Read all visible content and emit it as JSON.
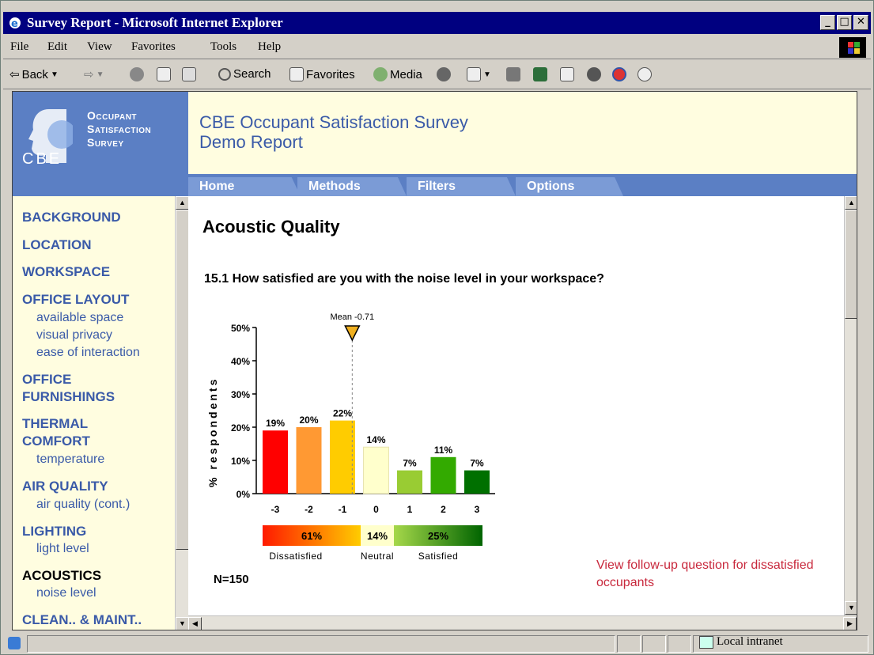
{
  "window": {
    "title": "Survey Report - Microsoft Internet Explorer",
    "min_label": "_",
    "max_label": "□",
    "close_label": "✕"
  },
  "menu": [
    "File",
    "Edit",
    "View",
    "Favorites",
    "Tools",
    "Help"
  ],
  "toolbar": {
    "back_label": "Back",
    "search_label": "Search",
    "favorites_label": "Favorites",
    "media_label": "Media"
  },
  "banner": {
    "logo_line1": "Occupant",
    "logo_line2": "Satisfaction",
    "logo_line3": "Survey",
    "logo_cbe": "CBE",
    "report_title_line1": "CBE Occupant Satisfaction Survey",
    "report_title_line2": "Demo Report"
  },
  "tabs": [
    "Home",
    "Methods",
    "Filters",
    "Options"
  ],
  "sidebar": {
    "items": [
      {
        "label": "BACKGROUND",
        "subs": []
      },
      {
        "label": "LOCATION",
        "subs": []
      },
      {
        "label": "WORKSPACE",
        "subs": []
      },
      {
        "label": "OFFICE LAYOUT",
        "subs": [
          "available space",
          "visual privacy",
          "ease of interaction"
        ]
      },
      {
        "label": "OFFICE\nFURNISHINGS",
        "subs": []
      },
      {
        "label": "THERMAL\nCOMFORT",
        "subs": [
          "temperature"
        ]
      },
      {
        "label": "AIR QUALITY",
        "subs": [
          "air quality (cont.)"
        ]
      },
      {
        "label": "LIGHTING",
        "subs": [
          "light level"
        ]
      },
      {
        "label": "ACOUSTICS",
        "subs": [
          "noise level"
        ],
        "current": true
      },
      {
        "label": "CLEAN.. & MAINT..",
        "subs": []
      }
    ]
  },
  "content": {
    "heading": "Acoustic Quality",
    "question": "15.1 How satisfied are you with the noise level in your workspace?",
    "n_label": "N=150",
    "followup_link": "View follow-up question for dissatisfied occupants"
  },
  "chart_data": {
    "type": "bar",
    "categories": [
      "-3",
      "-2",
      "-1",
      "0",
      "1",
      "2",
      "3"
    ],
    "values": [
      19,
      20,
      22,
      14,
      7,
      11,
      7
    ],
    "value_labels": [
      "19%",
      "20%",
      "22%",
      "14%",
      "7%",
      "11%",
      "7%"
    ],
    "colors": [
      "#ff0000",
      "#ff9933",
      "#ffcc00",
      "#ffffcc",
      "#99cc33",
      "#33aa00",
      "#007000"
    ],
    "ylabel": "% respondents",
    "yticks": [
      "0%",
      "10%",
      "20%",
      "30%",
      "40%",
      "50%"
    ],
    "ylim": [
      0,
      50
    ],
    "mean_label": "Mean -0.71",
    "mean_value": -0.71,
    "summary": [
      {
        "label": "Dissatisfied",
        "value": "61%"
      },
      {
        "label": "Neutral",
        "value": "14%"
      },
      {
        "label": "Satisfied",
        "value": "25%"
      }
    ]
  },
  "status": {
    "zone_label": "Local intranet"
  },
  "colors": {
    "title_bar": "#000080",
    "banner_blue": "#5b7fc4",
    "banner_cream": "#fffde0",
    "link_blue": "#3a5aa8",
    "followup_red": "#c8283c"
  }
}
